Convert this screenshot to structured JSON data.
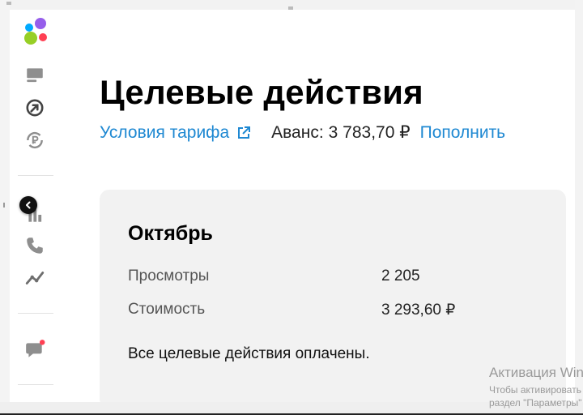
{
  "main": {
    "title": "Целевые действия",
    "tariff_link": "Условия тарифа",
    "advance_label": "Аванс:",
    "advance_value": "3 783,70 ₽",
    "topup_link": "Пополнить"
  },
  "card": {
    "month": "Октябрь",
    "stats": [
      {
        "label": "Просмотры",
        "value": "2 205"
      },
      {
        "label": "Стоимость",
        "value": "3 293,60 ₽"
      }
    ],
    "status": "Все целевые действия оплачены."
  },
  "sidebar": {
    "icons": [
      "listings-icon",
      "promotion-icon",
      "ruble-cycle-icon",
      "stats-icon",
      "phone-icon",
      "analytics-icon",
      "messenger-icon"
    ],
    "logo_colors": [
      "#0af",
      "#97cf26",
      "#ff4053",
      "#965eeb"
    ],
    "notification_color": "#ff4053"
  },
  "watermark": {
    "title": "Активация Win",
    "subtitle": "Чтобы активировать",
    "line2": "раздел \"Параметры\""
  },
  "colors": {
    "link": "#1e88d2",
    "card_bg": "#f2f2f2"
  }
}
